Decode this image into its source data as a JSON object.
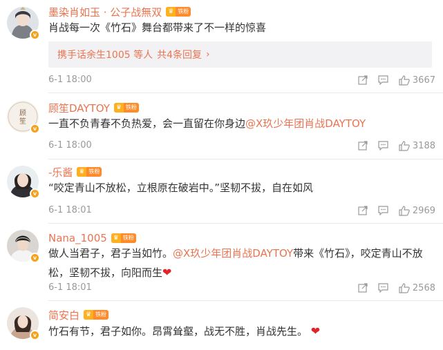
{
  "colors": {
    "accent": "#eb7350",
    "text": "#333333",
    "meta": "#999999",
    "reply_bg": "#f2f2f5",
    "heart": "#e0242b",
    "vip_badge": "#f7a11a"
  },
  "fan_badge_label": "铁粉",
  "vip_badge_letter": "v",
  "comments": [
    {
      "username": "墨染肖如玉 · 公子战無双",
      "text": "肖战每一次《竹石》舞台都带来了不一样的惊喜",
      "reply": {
        "who": "携手话余生1005 等人",
        "count": "共4条回复",
        "arrow": "›"
      },
      "time": "6-1 18:00",
      "likes": "3667"
    },
    {
      "username": "顾笙DAYTOY",
      "text_before": "一直不负青春不负热爱，会一直留在你身边",
      "mention": "@X玖少年团肖战DAYTOY",
      "time": "6-1 18:00",
      "likes": "3188"
    },
    {
      "username": "-乐酱",
      "text": "“咬定青山不放松，立根原在破岩中。”坚韧不拔，自在如风",
      "time": "6-1 18:01",
      "likes": "2969"
    },
    {
      "username": "Nana_1005",
      "text_before": "做人当君子，君子当如竹。",
      "mention": "@X玖少年团肖战DAYTOY",
      "text_after": "带来《竹石》，咬定青山不放松，坚韧不拔，向阳而生",
      "time": "6-1 18:01",
      "likes": "2568"
    },
    {
      "username": "简安白",
      "text": "竹石有节，君子如你。昂霄耸壑，战无不胜，肖战先生。"
    }
  ]
}
